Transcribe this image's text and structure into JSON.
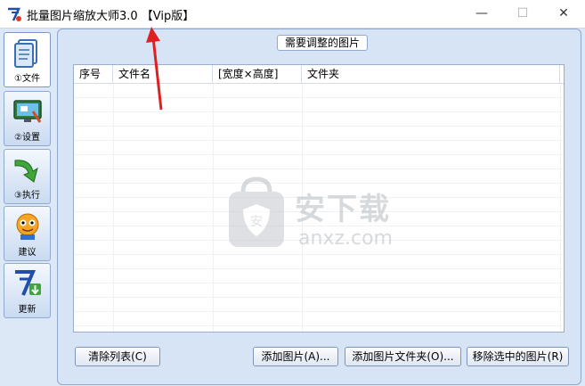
{
  "window": {
    "title": "批量图片缩放大师3.0 【Vip版】",
    "controls": {
      "minimize": "—",
      "maximize": "☐",
      "close": "✕"
    }
  },
  "sidebar": {
    "items": [
      {
        "label": "①文件",
        "icon": "document-icon",
        "active": true
      },
      {
        "label": "②设置",
        "icon": "settings-icon",
        "active": false
      },
      {
        "label": "③执行",
        "icon": "execute-arrow-icon",
        "active": false
      },
      {
        "label": "建议",
        "icon": "suggestion-mascot-icon",
        "active": false
      },
      {
        "label": "更新",
        "icon": "update-icon",
        "active": false
      }
    ]
  },
  "group": {
    "title": "需要调整的图片"
  },
  "table": {
    "columns": [
      "序号",
      "文件名",
      "[宽度×高度]",
      "文件夹"
    ],
    "rows": []
  },
  "watermark": {
    "main": "安下载",
    "sub": "anxz.com"
  },
  "buttons": {
    "clear": "清除列表(C)",
    "add_image": "添加图片(A)...",
    "add_folder": "添加图片文件夹(O)...",
    "remove_selected": "移除选中的图片(R)"
  },
  "colors": {
    "accent": "#e02020",
    "panel": "#d6e4f6",
    "border": "#8fa9cf"
  }
}
